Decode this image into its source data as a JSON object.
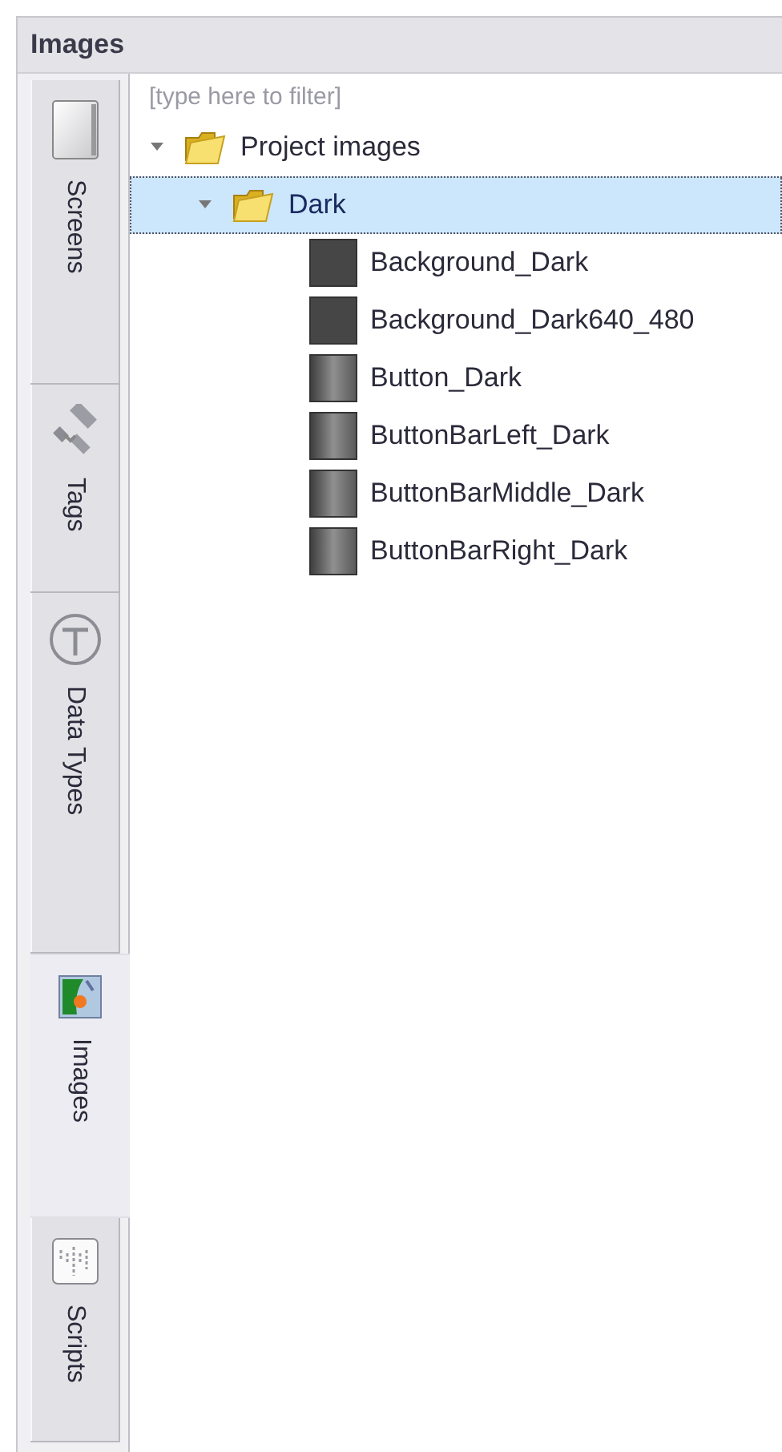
{
  "panel": {
    "title": "Images"
  },
  "side_tabs": [
    {
      "label": "Screens",
      "kind": "screens",
      "selected": false
    },
    {
      "label": "Tags",
      "kind": "tags",
      "selected": false
    },
    {
      "label": "Data Types",
      "kind": "datatypes",
      "selected": false
    },
    {
      "label": "Images",
      "kind": "images",
      "selected": true
    },
    {
      "label": "Scripts",
      "kind": "scripts",
      "selected": false
    }
  ],
  "filter": {
    "placeholder": "[type here to filter]"
  },
  "tree": [
    {
      "label": "Project images",
      "kind": "folder",
      "expanded": true,
      "selected": false,
      "children": [
        {
          "label": "Dark",
          "kind": "folder",
          "expanded": true,
          "selected": true,
          "children": [
            {
              "label": "Background_Dark",
              "kind": "image",
              "gradient": false,
              "selected": false
            },
            {
              "label": "Background_Dark640_480",
              "kind": "image",
              "gradient": false,
              "selected": false
            },
            {
              "label": "Button_Dark",
              "kind": "image",
              "gradient": true,
              "selected": false
            },
            {
              "label": "ButtonBarLeft_Dark",
              "kind": "image",
              "gradient": true,
              "selected": false
            },
            {
              "label": "ButtonBarMiddle_Dark",
              "kind": "image",
              "gradient": true,
              "selected": false
            },
            {
              "label": "ButtonBarRight_Dark",
              "kind": "image",
              "gradient": true,
              "selected": false
            }
          ]
        }
      ]
    }
  ]
}
